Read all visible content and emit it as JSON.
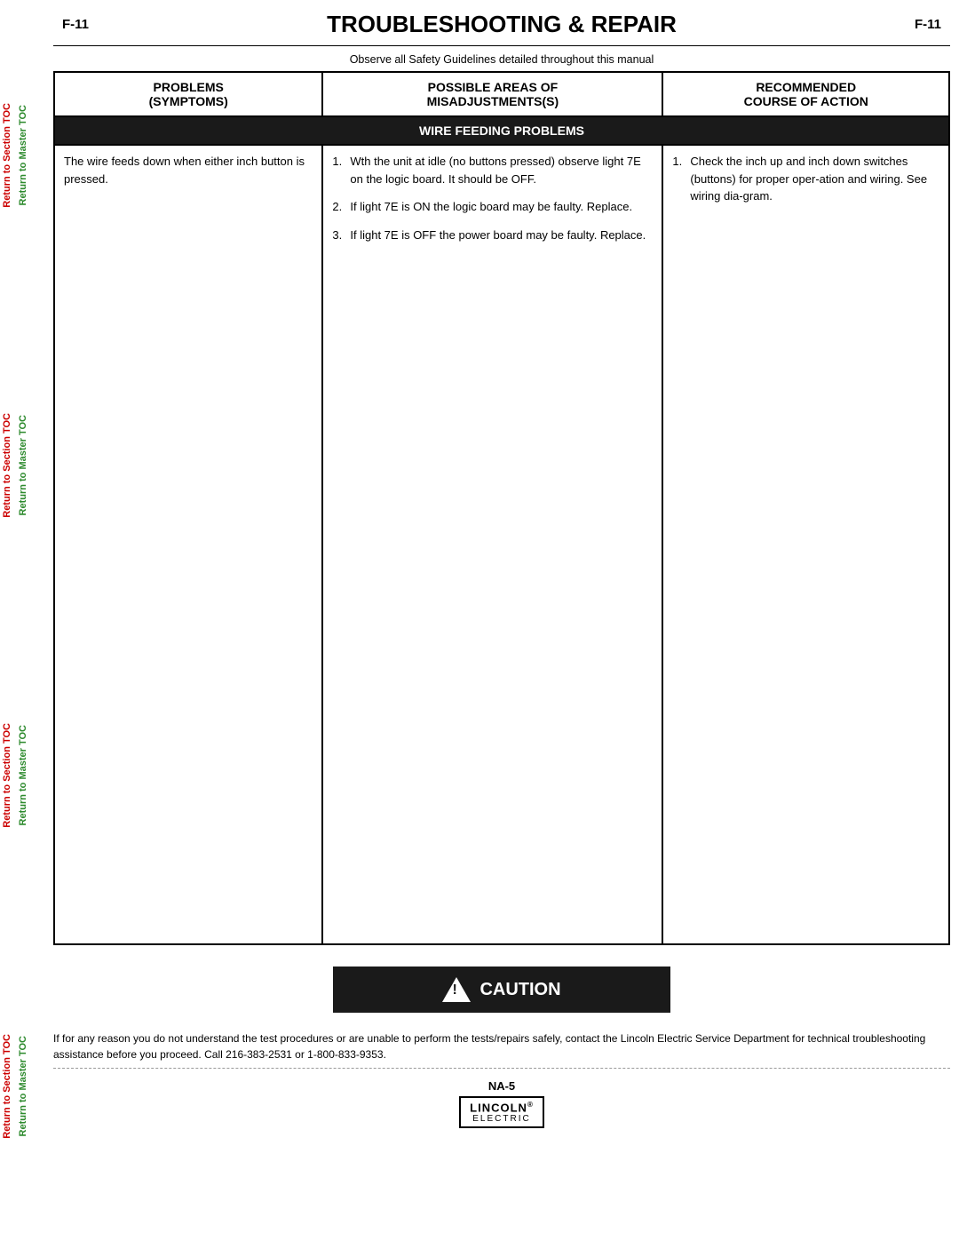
{
  "page": {
    "number": "F-11",
    "title": "TROUBLESHOOTING & REPAIR",
    "safety_note": "Observe all Safety Guidelines detailed throughout this manual"
  },
  "sidebar": {
    "groups": [
      {
        "items": [
          {
            "label": "Return to Section TOC",
            "color": "red"
          },
          {
            "label": "Return to Master TOC",
            "color": "green"
          }
        ]
      },
      {
        "items": [
          {
            "label": "Return to Section TOC",
            "color": "red"
          },
          {
            "label": "Return to Master TOC",
            "color": "green"
          }
        ]
      },
      {
        "items": [
          {
            "label": "Return to Section TOC",
            "color": "red"
          },
          {
            "label": "Return to Master TOC",
            "color": "green"
          }
        ]
      },
      {
        "items": [
          {
            "label": "Return to Section TOC",
            "color": "red"
          },
          {
            "label": "Return to Master TOC",
            "color": "green"
          }
        ]
      }
    ]
  },
  "table": {
    "headers": [
      {
        "label": "PROBLEMS\n(SYMPTOMS)"
      },
      {
        "label": "POSSIBLE AREAS OF\nMISADJUSTMENTS(S)"
      },
      {
        "label": "RECOMMENDED\nCOURSE OF ACTION"
      }
    ],
    "section_header": "WIRE FEEDING PROBLEMS",
    "rows": [
      {
        "problem": "The wire feeds down when either inch button is pressed.",
        "areas": [
          "Wth the unit at idle (no buttons pressed) observe light 7E on the logic board.  It should be OFF.",
          "If light 7E is ON the logic board may be faulty.  Replace.",
          "If light 7E is OFF the power board may be faulty.  Replace."
        ],
        "actions": [
          "Check the inch up and inch down switches (buttons) for proper oper-ation and wiring.  See wiring dia-gram."
        ]
      }
    ]
  },
  "caution": {
    "label": "CAUTION"
  },
  "footer": {
    "text": "If for any reason you do not understand the test procedures or are unable to perform the tests/repairs safely, contact the Lincoln Electric Service Department for technical troubleshooting assistance before you proceed. Call 216-383-2531 or 1-800-833-9353.",
    "page_id": "NA-5",
    "brand_name": "LINCOLN",
    "brand_r": "®",
    "brand_sub": "ELECTRIC"
  }
}
